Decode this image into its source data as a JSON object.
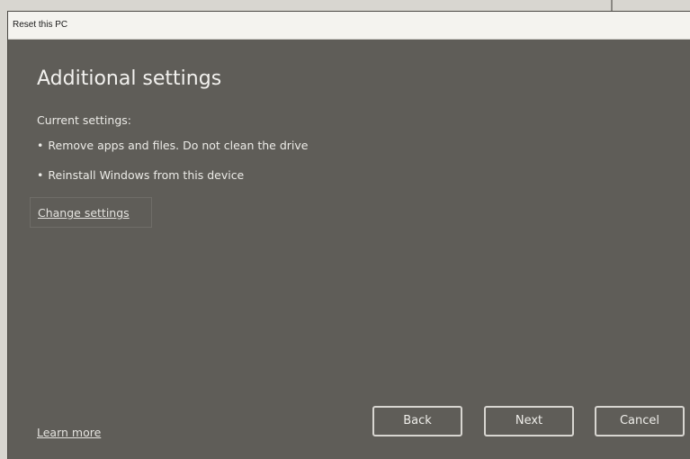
{
  "window": {
    "title": "Reset this PC"
  },
  "main": {
    "heading": "Additional settings",
    "current_settings_label": "Current settings:",
    "settings": [
      {
        "bullet": "•",
        "text": "Remove apps and files. Do not clean the drive"
      },
      {
        "bullet": "•",
        "text": "Reinstall Windows from this device"
      }
    ],
    "change_settings_link": "Change settings"
  },
  "footer": {
    "learn_more_link": "Learn more",
    "back_label": "Back",
    "next_label": "Next",
    "cancel_label": "Cancel"
  }
}
